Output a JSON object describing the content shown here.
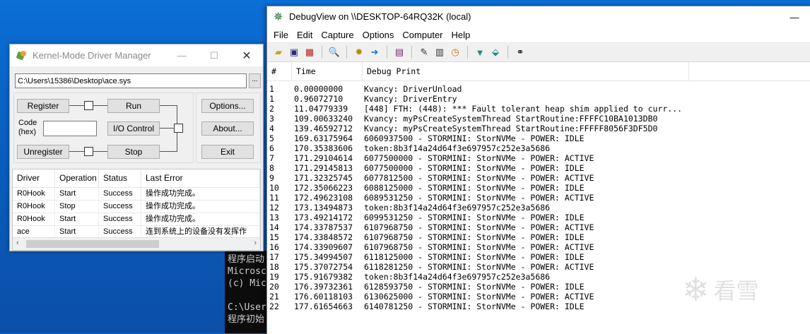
{
  "console": {
    "lines": [
      "程序启动",
      "Microsc",
      "(c) Mic",
      "",
      "C:\\User",
      "程序初始"
    ]
  },
  "kmdm": {
    "title": "Kernel-Mode Driver Manager",
    "path": "C:\\Users\\15386\\Desktop\\ace.sys",
    "browse": "...",
    "buttons": {
      "register": "Register",
      "run": "Run",
      "io_control": "I/O Control",
      "unregister": "Unregister",
      "stop": "Stop",
      "options": "Options...",
      "about": "About...",
      "exit": "Exit"
    },
    "code_label_1": "Code",
    "code_label_2": "(hex)",
    "code_value": "",
    "columns": [
      "Driver",
      "Operation",
      "Status",
      "Last Error"
    ],
    "rows": [
      [
        "R0Hook",
        "Start",
        "Success",
        "操作成功完成。"
      ],
      [
        "R0Hook",
        "Stop",
        "Success",
        "操作成功完成。"
      ],
      [
        "R0Hook",
        "Start",
        "Success",
        "操作成功完成。"
      ],
      [
        "ace",
        "Start",
        "Success",
        "连到系统上的设备没有发挥作"
      ]
    ]
  },
  "debugview": {
    "title": "DebugView on \\\\DESKTOP-64RQ32K (local)",
    "menu": [
      "File",
      "Edit",
      "Capture",
      "Options",
      "Computer",
      "Help"
    ],
    "columns": [
      "#",
      "Time",
      "Debug Print"
    ],
    "rows": [
      [
        "1",
        "0.00000000",
        "Kvancy: DriverUnload"
      ],
      [
        "1",
        "0.96072710",
        "Kvancy: DriverEntry"
      ],
      [
        "2",
        "11.04779339",
        "[448] FTH: (448): *** Fault tolerant heap shim applied to curr..."
      ],
      [
        "3",
        "109.00633240",
        "Kvancy: myPsCreateSystemThread StartRoutine:FFFFC10BA1013DB0"
      ],
      [
        "4",
        "139.46592712",
        "Kvancy: myPsCreateSystemThread StartRoutine:FFFFF8056F3DF5D0"
      ],
      [
        "5",
        "169.63175964",
        "6060937500 - STORMINI: StorNVMe - POWER: IDLE"
      ],
      [
        "6",
        "170.35383606",
        "token:8b3f14a24d64f3e697957c252e3a5686"
      ],
      [
        "7",
        "171.29104614",
        "6077500000 - STORMINI: StorNVMe - POWER: ACTIVE"
      ],
      [
        "8",
        "171.29145813",
        "6077500000 - STORMINI: StorNVMe - POWER: IDLE"
      ],
      [
        "9",
        "171.32325745",
        "6077812500 - STORMINI: StorNVMe - POWER: ACTIVE"
      ],
      [
        "10",
        "172.35066223",
        "6088125000 - STORMINI: StorNVMe - POWER: IDLE"
      ],
      [
        "11",
        "172.49623108",
        "6089531250 - STORMINI: StorNVMe - POWER: ACTIVE"
      ],
      [
        "12",
        "173.13494873",
        "token:8b3f14a24d64f3e697957c252e3a5686"
      ],
      [
        "13",
        "173.49214172",
        "6099531250 - STORMINI: StorNVMe - POWER: IDLE"
      ],
      [
        "14",
        "174.33787537",
        "6107968750 - STORMINI: StorNVMe - POWER: ACTIVE"
      ],
      [
        "15",
        "174.33848572",
        "6107968750 - STORMINI: StorNVMe - POWER: IDLE"
      ],
      [
        "16",
        "174.33909607",
        "6107968750 - STORMINI: StorNVMe - POWER: ACTIVE"
      ],
      [
        "17",
        "175.34994507",
        "6118125000 - STORMINI: StorNVMe - POWER: IDLE"
      ],
      [
        "18",
        "175.37072754",
        "6118281250 - STORMINI: StorNVMe - POWER: ACTIVE"
      ],
      [
        "19",
        "175.91679382",
        "token:8b3f14a24d64f3e697957c252e3a5686"
      ],
      [
        "20",
        "176.39732361",
        "6128593750 - STORMINI: StorNVMe - POWER: IDLE"
      ],
      [
        "21",
        "176.60118103",
        "6130625000 - STORMINI: StorNVMe - POWER: ACTIVE"
      ],
      [
        "22",
        "177.61654663",
        "6140781250 - STORMINI: StorNVMe - POWER: IDLE"
      ]
    ]
  },
  "watermark": {
    "text": "看雪"
  }
}
